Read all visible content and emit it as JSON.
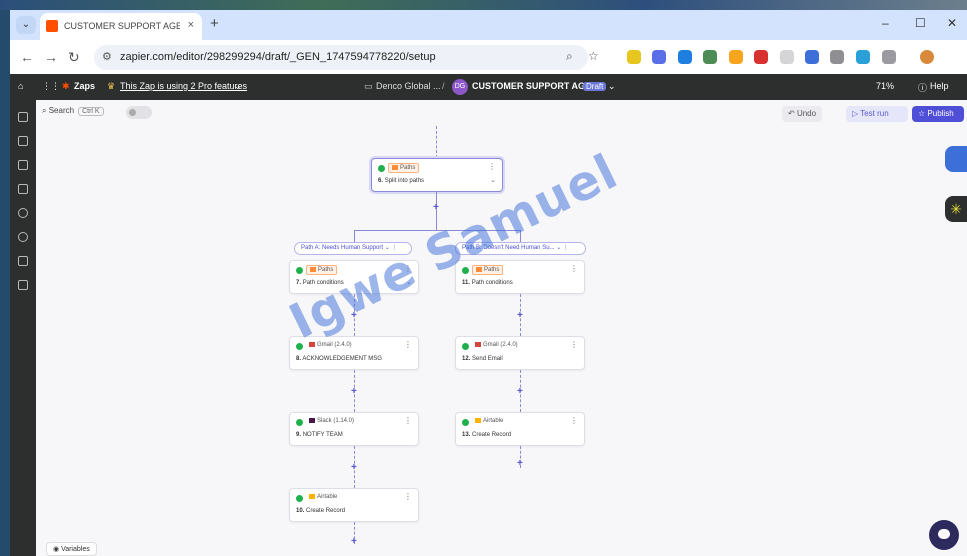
{
  "browser": {
    "tab_title": "CUSTOMER SUPPORT AGENT | ...",
    "new_tab": "+",
    "url": "zapier.com/editor/298299294/draft/_GEN_1747594778220/setup",
    "window_controls": {
      "minimize": "–",
      "maximize": "☐",
      "close": "✕"
    }
  },
  "topbar": {
    "brand": "Zaps",
    "pro_notice": "This Zap is using 2 Pro features",
    "folder": "Denco Global ...",
    "separator": "/",
    "avatar": "DG",
    "zap_name": "CUSTOMER SUPPORT AGENT",
    "status": "Draft",
    "zoom": "71%",
    "help": "Help"
  },
  "canvas_toolbar": {
    "search": "Search",
    "shortcut": "Ctrl K",
    "undo": "Undo",
    "test_run": "Test run",
    "publish": "Publish"
  },
  "steps": {
    "split": {
      "app": "Paths",
      "num": "6.",
      "title": "Split into paths"
    },
    "path_a_label": "Path A: Needs Human Support",
    "path_b_label": "Path B: Doesn't Need Human Su...",
    "a1": {
      "app": "Paths",
      "num": "7.",
      "title": "Path conditions"
    },
    "a2": {
      "app": "Gmail (2.4.0)",
      "num": "8.",
      "title": "ACKNOWLEDGEMENT MSG"
    },
    "a3": {
      "app": "Slack (1.14.0)",
      "num": "9.",
      "title": "NOTIFY TEAM"
    },
    "a4": {
      "app": "Airtable",
      "num": "10.",
      "title": "Create Record"
    },
    "b1": {
      "app": "Paths",
      "num": "11.",
      "title": "Path conditions"
    },
    "b2": {
      "app": "Gmail (2.4.0)",
      "num": "12.",
      "title": "Send Email"
    },
    "b3": {
      "app": "Airtable",
      "num": "13.",
      "title": "Create Record"
    }
  },
  "watermark": "Igwe Samuel",
  "bottom": {
    "variables": "Variables"
  },
  "colors": {
    "accent": "#4e4ed6",
    "zapier_orange": "#ff4f00",
    "success": "#20b04b",
    "topbar": "#2d2e2e"
  }
}
